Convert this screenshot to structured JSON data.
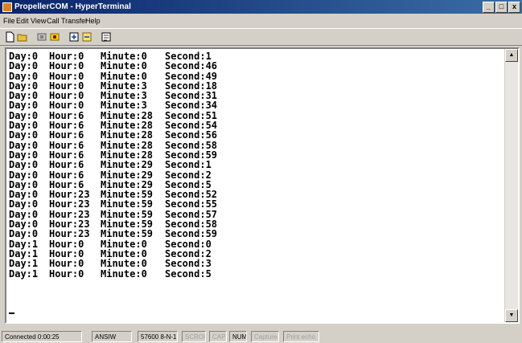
{
  "window": {
    "title": "PropellerCOM - HyperTerminal",
    "minimize": "_",
    "maximize": "□",
    "close": "x"
  },
  "menu": [
    "File",
    "Edit",
    "View",
    "Call",
    "Transfer",
    "Help"
  ],
  "toolbar": [
    "new-icon",
    "open-icon",
    "disconnect-icon",
    "connect-icon",
    "send-icon",
    "receive-icon",
    "properties-icon"
  ],
  "terminal": {
    "lines": [
      [
        "Day:0",
        "Hour:0",
        "Minute:0",
        "Second:1"
      ],
      [
        "Day:0",
        "Hour:0",
        "Minute:0",
        "Second:46"
      ],
      [
        "Day:0",
        "Hour:0",
        "Minute:0",
        "Second:49"
      ],
      [
        "Day:0",
        "Hour:0",
        "Minute:3",
        "Second:18"
      ],
      [
        "Day:0",
        "Hour:0",
        "Minute:3",
        "Second:31"
      ],
      [
        "Day:0",
        "Hour:0",
        "Minute:3",
        "Second:34"
      ],
      [
        "Day:0",
        "Hour:6",
        "Minute:28",
        "Second:51"
      ],
      [
        "Day:0",
        "Hour:6",
        "Minute:28",
        "Second:54"
      ],
      [
        "Day:0",
        "Hour:6",
        "Minute:28",
        "Second:56"
      ],
      [
        "Day:0",
        "Hour:6",
        "Minute:28",
        "Second:58"
      ],
      [
        "Day:0",
        "Hour:6",
        "Minute:28",
        "Second:59"
      ],
      [
        "Day:0",
        "Hour:6",
        "Minute:29",
        "Second:1"
      ],
      [
        "Day:0",
        "Hour:6",
        "Minute:29",
        "Second:2"
      ],
      [
        "Day:0",
        "Hour:6",
        "Minute:29",
        "Second:5"
      ],
      [
        "Day:0",
        "Hour:23",
        "Minute:59",
        "Second:52"
      ],
      [
        "Day:0",
        "Hour:23",
        "Minute:59",
        "Second:55"
      ],
      [
        "Day:0",
        "Hour:23",
        "Minute:59",
        "Second:57"
      ],
      [
        "Day:0",
        "Hour:23",
        "Minute:59",
        "Second:58"
      ],
      [
        "Day:0",
        "Hour:23",
        "Minute:59",
        "Second:59"
      ],
      [
        "Day:1",
        "Hour:0",
        "Minute:0",
        "Second:0"
      ],
      [
        "Day:1",
        "Hour:0",
        "Minute:0",
        "Second:2"
      ],
      [
        "Day:1",
        "Hour:0",
        "Minute:0",
        "Second:3"
      ],
      [
        "Day:1",
        "Hour:0",
        "Minute:0",
        "Second:5"
      ]
    ]
  },
  "status": {
    "connected": "Connected 0:00:25",
    "emulation": "ANSIW",
    "port_settings": "57600 8-N-1",
    "scroll": "SCROLL",
    "caps": "CAPS",
    "num": "NUM",
    "capture": "Capture",
    "print_echo": "Print echo"
  },
  "colors": {
    "title_start": "#0a246a",
    "title_end": "#3a6ea5",
    "chrome": "#d4d0c8"
  }
}
